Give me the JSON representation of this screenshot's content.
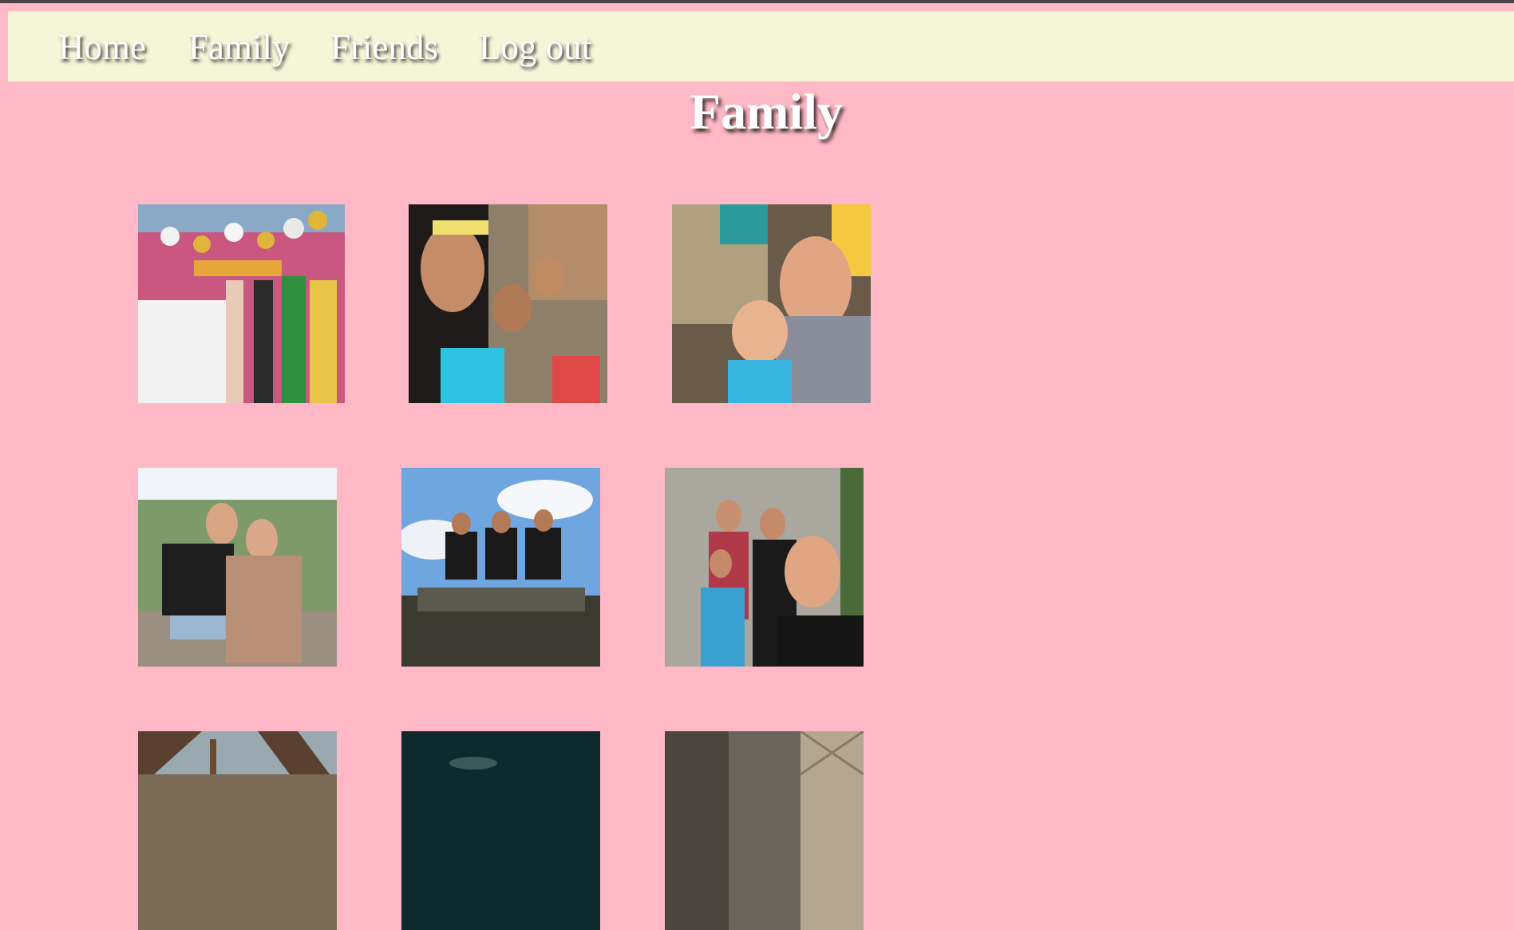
{
  "nav": {
    "links": [
      {
        "label": "Home"
      },
      {
        "label": "Family"
      },
      {
        "label": "Friends"
      },
      {
        "label": "Log out"
      }
    ]
  },
  "page": {
    "title": "Family",
    "background_color": "#ffb9c6",
    "nav_background_color": "#f5f5d8"
  },
  "gallery": {
    "photos": [
      {
        "description": "birthday party group with balloons"
      },
      {
        "description": "group selfie of children"
      },
      {
        "description": "woman with toddler selfie"
      },
      {
        "description": "two women embracing outdoors"
      },
      {
        "description": "three women seated on bench under sky"
      },
      {
        "description": "family group selfie by wall"
      },
      {
        "description": "photo under roof beams"
      },
      {
        "description": "dark photo"
      },
      {
        "description": "photo of wooden house wall"
      }
    ]
  }
}
